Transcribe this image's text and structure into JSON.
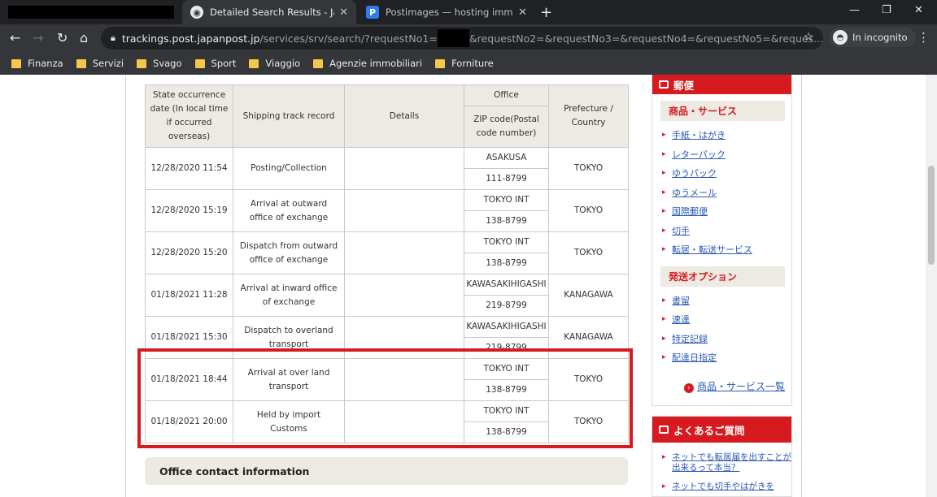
{
  "browser": {
    "tabs": [
      {
        "title": "Detailed Search Results - Japan P"
      },
      {
        "title": "Postimages — hosting immagini"
      }
    ],
    "new_tab": "+",
    "url_host": "trackings.post.japanpost.jp",
    "url_path": "/services/srv/search/?requestNo1=",
    "url_tail": "&requestNo2=&requestNo3=&requestNo4=&requestNo5=&reques...",
    "incognito_label": "In incognito",
    "bookmarks": [
      "Finanza",
      "Servizi",
      "Svago",
      "Sport",
      "Viaggio",
      "Agenzie immobiliari",
      "Forniture"
    ]
  },
  "table": {
    "headers": {
      "date": "State occurrence date (In local time if occurred overseas)",
      "record": "Shipping track record",
      "details": "Details",
      "office": "Office",
      "zip": "ZIP code(Postal code number)",
      "prefecture": "Prefecture / Country"
    },
    "rows": [
      {
        "date": "12/28/2020 11:54",
        "record": "Posting/Collection",
        "details": "",
        "office": "ASAKUSA",
        "zip": "111-8799",
        "prefecture": "TOKYO"
      },
      {
        "date": "12/28/2020 15:19",
        "record": "Arrival at outward office of exchange",
        "details": "",
        "office": "TOKYO INT",
        "zip": "138-8799",
        "prefecture": "TOKYO"
      },
      {
        "date": "12/28/2020 15:20",
        "record": "Dispatch from outward office of exchange",
        "details": "",
        "office": "TOKYO INT",
        "zip": "138-8799",
        "prefecture": "TOKYO"
      },
      {
        "date": "01/18/2021 11:28",
        "record": "Arrival at inward office of exchange",
        "details": "",
        "office": "KAWASAKIHIGASHI",
        "zip": "219-8799",
        "prefecture": "KANAGAWA"
      },
      {
        "date": "01/18/2021 15:30",
        "record": "Dispatch to overland transport",
        "details": "",
        "office": "KAWASAKIHIGASHI",
        "zip": "219-8799",
        "prefecture": "KANAGAWA"
      },
      {
        "date": "01/18/2021 18:44",
        "record": "Arrival at over land transport",
        "details": "",
        "office": "TOKYO INT",
        "zip": "138-8799",
        "prefecture": "TOKYO"
      },
      {
        "date": "01/18/2021 20:00",
        "record": "Held by import Customs",
        "details": "",
        "office": "TOKYO INT",
        "zip": "138-8799",
        "prefecture": "TOKYO"
      }
    ]
  },
  "office_contact": "Office contact information",
  "sidebar": {
    "mail_header": "郵便",
    "products_title": "商品・サービス",
    "products": [
      "手紙・はがき",
      "レターパック",
      "ゆうパック",
      "ゆうメール",
      "国際郵便",
      "切手",
      "転居・転送サービス"
    ],
    "options_title": "発送オプション",
    "options": [
      "書留",
      "速達",
      "特定記録",
      "配達日指定"
    ],
    "more_link": "商品・サービス一覧",
    "faq_header": "よくあるご質問",
    "faq": [
      "ネットでも転居届を出すことが出来るって本当？",
      "ネットでも切手やはがきを"
    ]
  }
}
